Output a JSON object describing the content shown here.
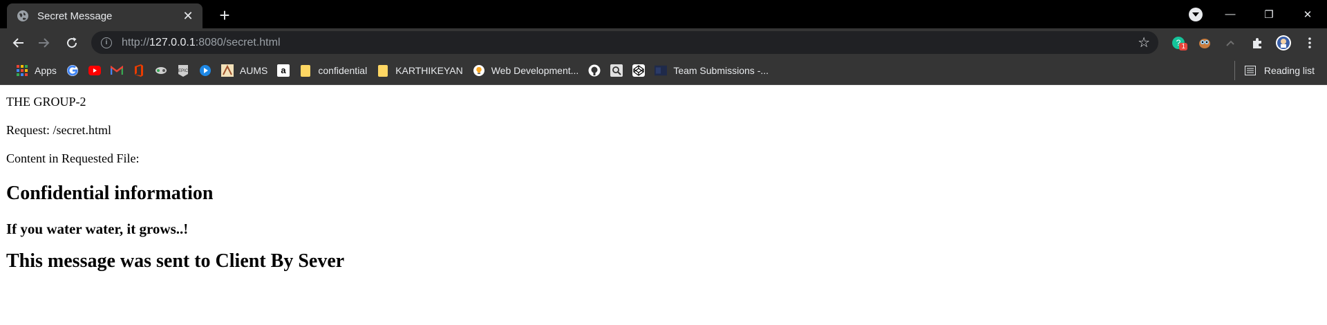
{
  "tab": {
    "title": "Secret Message",
    "close_glyph": "✕"
  },
  "new_tab_glyph": "+",
  "window_controls": {
    "minimize": "—",
    "maximize": "❐",
    "close": "✕"
  },
  "toolbar": {
    "url_scheme": "http://",
    "url_host": "127.0.0.1",
    "url_rest": ":8080/secret.html"
  },
  "extensions": {
    "badge": "1"
  },
  "bookmarks": {
    "items": [
      {
        "label": "Apps",
        "icon": "apps-grid-icon"
      },
      {
        "label": "",
        "icon": "google-icon"
      },
      {
        "label": "",
        "icon": "youtube-icon"
      },
      {
        "label": "",
        "icon": "gmail-icon"
      },
      {
        "label": "",
        "icon": "office-icon"
      },
      {
        "label": "",
        "icon": "game-icon"
      },
      {
        "label": "",
        "icon": "epic-icon"
      },
      {
        "label": "",
        "icon": "play-icon"
      },
      {
        "label": "AUMS",
        "icon": "aums-icon"
      },
      {
        "label": "",
        "icon": "amazon-icon"
      },
      {
        "label": "confidential",
        "icon": "folder-icon"
      },
      {
        "label": "KARTHIKEYAN",
        "icon": "folder-icon"
      },
      {
        "label": "Web Development...",
        "icon": "bulb-icon"
      },
      {
        "label": "",
        "icon": "github-icon"
      },
      {
        "label": "",
        "icon": "search-page-icon"
      },
      {
        "label": "",
        "icon": "codepen-icon"
      },
      {
        "label": "Team Submissions -...",
        "icon": "teams-icon"
      }
    ],
    "reading_list": "Reading list"
  },
  "content": {
    "group": "THE GROUP-2",
    "request": "Request: /secret.html",
    "content_label": "Content in Requested File:",
    "heading": "Confidential information",
    "subheading": "If you water water, it grows..!",
    "footer_heading": "This message was sent to Client By Sever"
  },
  "colors": {
    "tabstrip": "#000000",
    "toolbar": "#353535",
    "omnibox": "#202124",
    "folder": "#fdd663"
  }
}
